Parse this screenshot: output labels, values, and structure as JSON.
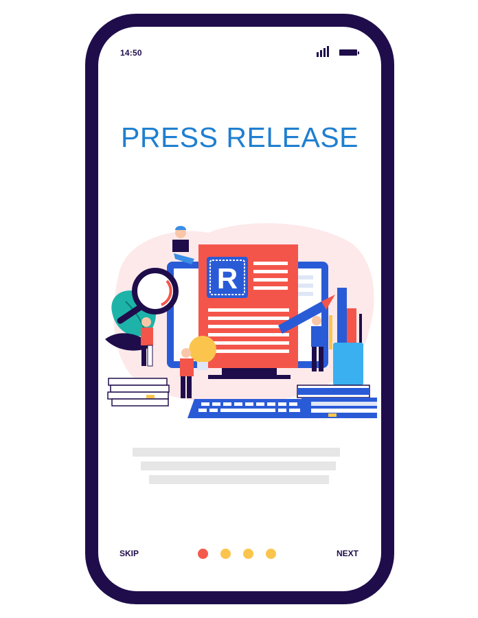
{
  "status_bar": {
    "time": "14:50"
  },
  "main": {
    "title": "PRESS RELEASE",
    "illustration_letter": "R"
  },
  "footer": {
    "skip_label": "SKIP",
    "next_label": "NEXT",
    "page_count": 4,
    "active_page": 1
  },
  "colors": {
    "phone_frame": "#1f0d4b",
    "title": "#1f7fd0",
    "dot_active": "#f45b4e",
    "dot_inactive": "#fbc54d",
    "placeholder_line": "#e6e6e6"
  },
  "icons": {
    "signal": "signal-bars-icon",
    "battery": "battery-icon"
  }
}
